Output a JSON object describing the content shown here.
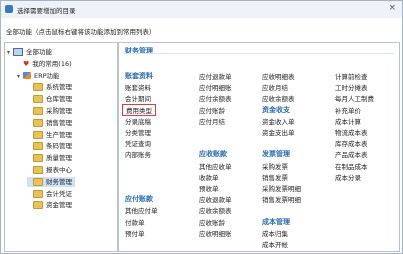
{
  "window": {
    "title": "选择需要增加的目录",
    "close_label": "×"
  },
  "hint": "全部功能（点击鼠标右键将该功能添加到常用列表）",
  "tree": [
    {
      "label": "全部功能",
      "icon": "computer-icon",
      "level": 0,
      "toggle": "▾"
    },
    {
      "label": "我的常用(16)",
      "icon": "heart-icon",
      "level": 1,
      "toggle": ""
    },
    {
      "label": "ERP功能",
      "icon": "erp-icon",
      "level": 1,
      "toggle": "▾"
    },
    {
      "label": "系统管理",
      "icon": "folder-icon",
      "level": 2,
      "toggle": ""
    },
    {
      "label": "仓库管理",
      "icon": "folder-icon",
      "level": 2,
      "toggle": ""
    },
    {
      "label": "采购管理",
      "icon": "folder-icon",
      "level": 2,
      "toggle": ""
    },
    {
      "label": "销售管理",
      "icon": "folder-icon",
      "level": 2,
      "toggle": ""
    },
    {
      "label": "生产管理",
      "icon": "folder-icon",
      "level": 2,
      "toggle": ""
    },
    {
      "label": "条码管理",
      "icon": "folder-icon",
      "level": 2,
      "toggle": ""
    },
    {
      "label": "质量管理",
      "icon": "folder-icon",
      "level": 2,
      "toggle": ""
    },
    {
      "label": "报表中心",
      "icon": "folder-icon",
      "level": 2,
      "toggle": ""
    },
    {
      "label": "财务管理",
      "icon": "folder-icon",
      "level": 2,
      "toggle": "",
      "selected": true
    },
    {
      "label": "会计凭证",
      "icon": "folder-icon",
      "level": 2,
      "toggle": ""
    },
    {
      "label": "资金管理",
      "icon": "folder-icon",
      "level": 2,
      "toggle": ""
    }
  ],
  "section_title": "财务管理",
  "groups": [
    {
      "title": "账套资料",
      "col": 0,
      "row": 0
    },
    {
      "title": "应付账款",
      "col": 0,
      "row": 11
    },
    {
      "title": "应收账款",
      "col": 1,
      "row": 7
    },
    {
      "title": "资金收支",
      "col": 2,
      "row": 3
    },
    {
      "title": "发票管理",
      "col": 2,
      "row": 7
    },
    {
      "title": "成本管理",
      "col": 2,
      "row": 13
    }
  ],
  "items": [
    {
      "label": "账套资料",
      "col": 0,
      "row": 1
    },
    {
      "label": "会计期间",
      "col": 0,
      "row": 2
    },
    {
      "label": "费用类型",
      "col": 0,
      "row": 3,
      "highlight": true
    },
    {
      "label": "分录底稿",
      "col": 0,
      "row": 4
    },
    {
      "label": "分类管理",
      "col": 0,
      "row": 5
    },
    {
      "label": "凭证查询",
      "col": 0,
      "row": 6
    },
    {
      "label": "内部账务",
      "col": 0,
      "row": 7
    },
    {
      "label": "其他应付单",
      "col": 0,
      "row": 12
    },
    {
      "label": "付款单",
      "col": 0,
      "row": 13
    },
    {
      "label": "预付单",
      "col": 0,
      "row": 14
    },
    {
      "label": "应付退款单",
      "col": 1,
      "row": 0
    },
    {
      "label": "应付明细账",
      "col": 1,
      "row": 1
    },
    {
      "label": "应付余额表",
      "col": 1,
      "row": 2
    },
    {
      "label": "应付账龄",
      "col": 1,
      "row": 3
    },
    {
      "label": "应付月结",
      "col": 1,
      "row": 4
    },
    {
      "label": "其他应收单",
      "col": 1,
      "row": 8
    },
    {
      "label": "收款单",
      "col": 1,
      "row": 9
    },
    {
      "label": "预收单",
      "col": 1,
      "row": 10
    },
    {
      "label": "应收退款单",
      "col": 1,
      "row": 11
    },
    {
      "label": "应收余额表",
      "col": 1,
      "row": 12
    },
    {
      "label": "应收账龄",
      "col": 1,
      "row": 13
    },
    {
      "label": "应收明细账",
      "col": 1,
      "row": 14
    },
    {
      "label": "应收明细表",
      "col": 2,
      "row": 0
    },
    {
      "label": "应收月结",
      "col": 2,
      "row": 1
    },
    {
      "label": "应收余额表",
      "col": 2,
      "row": 2
    },
    {
      "label": "资金收入单",
      "col": 2,
      "row": 4
    },
    {
      "label": "资金支出单",
      "col": 2,
      "row": 5
    },
    {
      "label": "采购发票",
      "col": 2,
      "row": 8
    },
    {
      "label": "销售发票",
      "col": 2,
      "row": 9
    },
    {
      "label": "采购发票明细",
      "col": 2,
      "row": 10
    },
    {
      "label": "销售发票明细",
      "col": 2,
      "row": 11
    },
    {
      "label": "成本归集",
      "col": 2,
      "row": 14
    },
    {
      "label": "成本开帐",
      "col": 2,
      "row": 15
    },
    {
      "label": "计算前检查",
      "col": 3,
      "row": 0
    },
    {
      "label": "工时分摊表",
      "col": 3,
      "row": 1
    },
    {
      "label": "每月人工制费",
      "col": 3,
      "row": 2
    },
    {
      "label": "补充单价",
      "col": 3,
      "row": 3
    },
    {
      "label": "成本计算",
      "col": 3,
      "row": 4
    },
    {
      "label": "物流成本表",
      "col": 3,
      "row": 5
    },
    {
      "label": "库存成本表",
      "col": 3,
      "row": 6
    },
    {
      "label": "产品成本表",
      "col": 3,
      "row": 7
    },
    {
      "label": "在制品成本",
      "col": 3,
      "row": 8
    },
    {
      "label": "成本分录",
      "col": 3,
      "row": 9
    }
  ]
}
